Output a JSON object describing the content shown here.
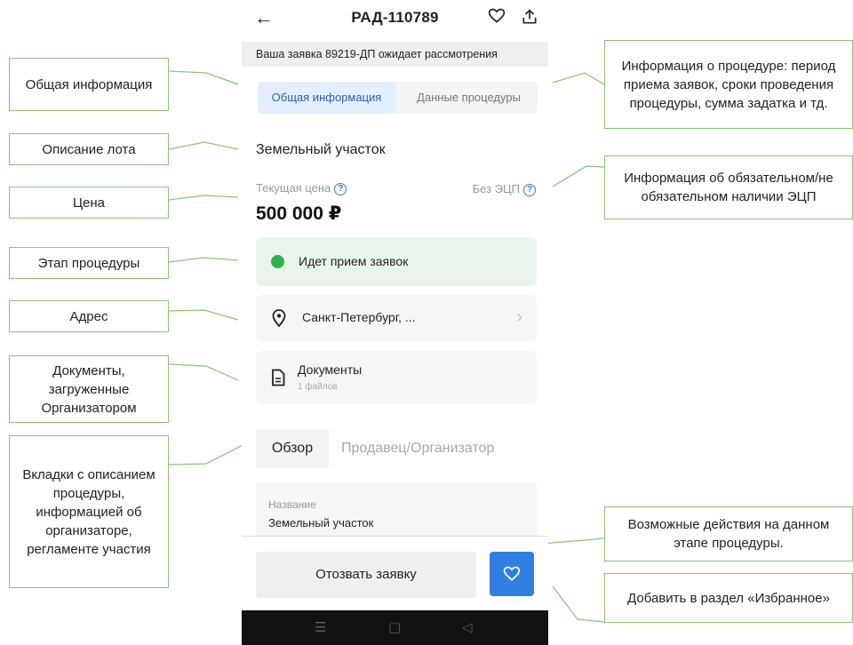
{
  "phone": {
    "title": "РАД-110789",
    "banner": "Ваша заявка 89219-ДП ожидает рассмотрения",
    "tabs": [
      "Общая информация",
      "Данные процедуры"
    ],
    "lot_name": "Земельный участок",
    "price_label": "Текущая цена",
    "ecp_label": "Без ЭЦП",
    "price": "500 000 ₽",
    "stage": "Идет прием заявок",
    "address": "Санкт-Петербург, ...",
    "documents_title": "Документы",
    "documents_count": "1 файлов",
    "overview_tabs": [
      "Обзор",
      "Продавец/Организатор"
    ],
    "overview_label": "Название",
    "overview_value": "Земельный участок",
    "withdraw_button": "Отозвать заявку",
    "colors": {
      "accent": "#2f7fe0",
      "stage_bg": "#e9f4ec",
      "stage_dot": "#2fb152",
      "tab_active_bg": "#e3efff"
    }
  },
  "annotations": {
    "general_info": "Общая информация",
    "lot_description": "Описание лота",
    "price": "Цена",
    "stage": "Этап процедуры",
    "address": "Адрес",
    "documents": "Документы, загруженные Организатором",
    "tabs": "Вкладки с описанием процедуры, информацией об организаторе, регламенте участия",
    "procedure_info": "Информация о процедуре: период приема заявок, сроки проведения процедуры, сумма задатка и тд.",
    "ecp_info": "Информация об обязательном/не обязательном наличии ЭЦП",
    "actions": "Возможные действия на данном этапе процедуры.",
    "favorites": "Добавить в раздел «Избранное»"
  }
}
